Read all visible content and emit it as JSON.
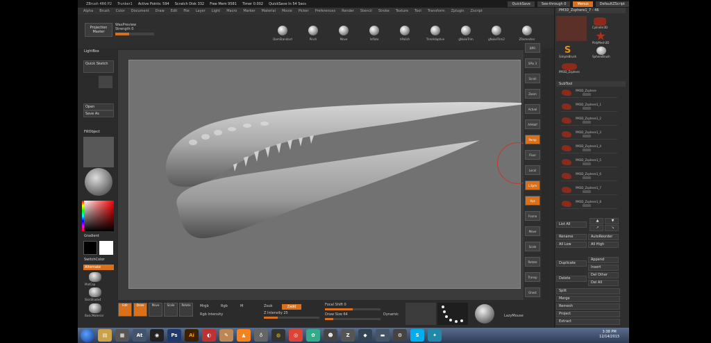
{
  "titlebar": {
    "app": "ZBrush 4R6 P2",
    "doc": "Trunker1",
    "active_points": "Active Points: 594",
    "scratch": "Scratch Disk 332",
    "free_mem": "Free Mem 9581",
    "timer": "Timer 0.002",
    "quicksave": "QuickSave In 54 Secs",
    "btn_quicksave": "QuickSave",
    "btn_seethrough": "See-through 0",
    "btn_menus": "Menus",
    "btn_script": "DefaultZScript"
  },
  "menubar": [
    "Alpha",
    "Brush",
    "Color",
    "Document",
    "Draw",
    "Edit",
    "File",
    "Layer",
    "Light",
    "Macro",
    "Marker",
    "Material",
    "Movie",
    "Picker",
    "Preferences",
    "Render",
    "Stencil",
    "Stroke",
    "Texture",
    "Tool",
    "Transform",
    "Zplugin",
    "Zscript"
  ],
  "shelf": {
    "projection_line1": "Projection",
    "projection_line2": "Master",
    "lightbox_label": "WaxPreview",
    "strength_label": "Strength 0",
    "brushes": [
      "DamStandard",
      "Pinch",
      "Move",
      "Inflate",
      "hPolish",
      "TrimAdaptive",
      "gNukeTrim",
      "gNukeTrim2",
      "ZRemesher"
    ]
  },
  "left": {
    "lightbox": "LightBox",
    "quick_sketch": "Quick Sketch",
    "open": "Open",
    "save_as": "Save As",
    "fill_object": "FillObject",
    "gradient": "Gradient",
    "switch_color": "SwitchColor",
    "alternate": "Alternate",
    "mats": [
      "MatCap",
      "SkinShade4",
      "BasicMaterial"
    ]
  },
  "right_shelf": [
    "BPR",
    "SPix 3",
    "Scroll",
    "Zoom",
    "Actual",
    "AAHalf",
    "Persp",
    "Floor",
    "Local",
    "L.Sym",
    "Xyz",
    "Frame",
    "Move",
    "Scale",
    "Rotate",
    "Transp",
    "Ghost",
    "Solo"
  ],
  "tool": {
    "current": "PM3D_Zsphere1_7 - 46",
    "icons": [
      "PM3D_Zsphere",
      "Cylinder3D",
      "PolyMesh3D",
      "SimpleBrush",
      "SphereBrush",
      "PM3D_Zsphere"
    ],
    "subtool_title": "SubTool",
    "subtools": [
      "PM3D_Zsphere",
      "PM3D_Zsphere1_1",
      "PM3D_Zsphere1_2",
      "PM3D_Zsphere1_3",
      "PM3D_Zsphere1_4",
      "PM3D_Zsphere1_5",
      "PM3D_Zsphere1_6",
      "PM3D_Zsphere1_7",
      "PM3D_Zsphere1_8"
    ],
    "list_all": "List All",
    "rename": "Rename",
    "autoreorder": "AutoReorder",
    "all_low": "All Low",
    "all_high": "All High",
    "duplicate": "Duplicate",
    "append": "Append",
    "insert": "Insert",
    "delete": "Delete",
    "del_other": "Del Other",
    "del_all": "Del All",
    "split": "Split",
    "merge": "Merge",
    "remesh": "Remesh",
    "project": "Project",
    "extract": "Extract"
  },
  "bottom": {
    "edit": "Edit",
    "draw": "Draw",
    "move": "Move",
    "scale": "Scale",
    "rotate": "Rotate",
    "mrgb": "Mrgb",
    "rgb": "Rgb",
    "m": "M",
    "zsub": "Zsub",
    "zadd": "Zadd",
    "rgb_intensity": "Rgb Intensity",
    "z_intensity": "Z Intensity 25",
    "focal_shift": "Focal Shift 0",
    "draw_size": "Draw Size 64",
    "dynamic": "Dynamic",
    "lazymouse": "LazyMouse"
  },
  "taskbar": {
    "time": "3:38 PM",
    "date": "12/14/2013"
  },
  "colors": {
    "accent": "#d9701c",
    "panel": "#2a2a2a",
    "canvas": "#727272"
  }
}
